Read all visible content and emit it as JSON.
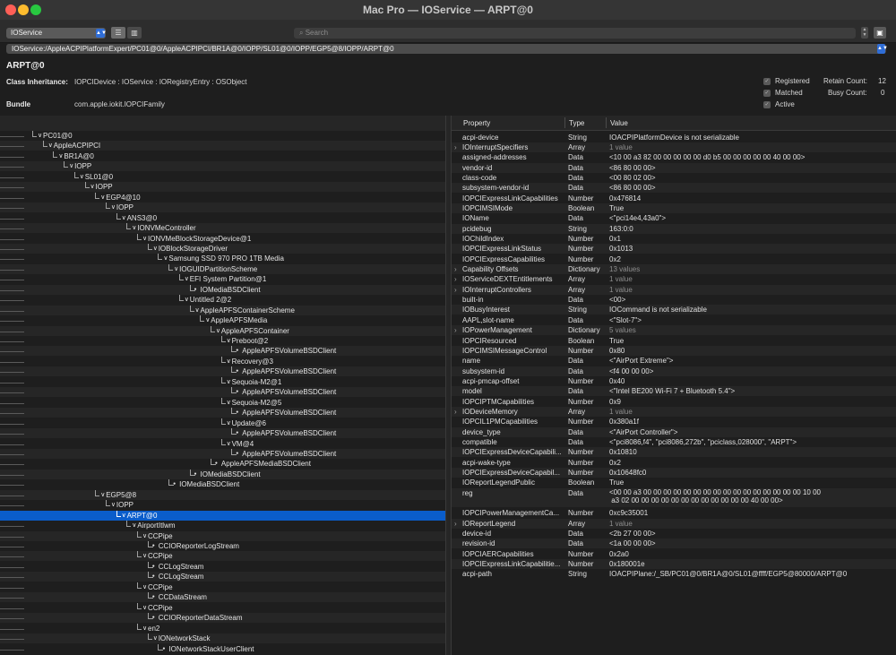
{
  "window": {
    "title": "Mac Pro — IOService — ARPT@0"
  },
  "toolbar": {
    "plane": "IOService",
    "search_placeholder": "Search",
    "view_list_icon": "list-icon",
    "view_browser_icon": "columns-icon"
  },
  "path": "IOService:/AppleACPIPlatformExpert/PC01@0/AppleACPIPCI/BR1A@0/IOPP/SL01@0/IOPP/EGP5@8/IOPP/ARPT@0",
  "entry": {
    "name": "ARPT@0",
    "class_label": "Class Inheritance:",
    "class_value": "IOPCIDevice : IOService : IORegistryEntry : OSObject",
    "bundle_label": "Bundle",
    "bundle_value": "com.apple.iokit.IOPCIFamily",
    "registered": "Registered",
    "matched": "Matched",
    "active": "Active",
    "retain_label": "Retain Count:",
    "retain_value": "12",
    "busy_label": "Busy Count:",
    "busy_value": "0"
  },
  "tree": [
    {
      "label": "PC01@0",
      "level": 0
    },
    {
      "label": "AppleACPIPCI",
      "level": 1
    },
    {
      "label": "BR1A@0",
      "level": 2
    },
    {
      "label": "IOPP",
      "level": 3
    },
    {
      "label": "SL01@0",
      "level": 4
    },
    {
      "label": "IOPP",
      "level": 5
    },
    {
      "label": "EGP4@10",
      "level": 6
    },
    {
      "label": "IOPP",
      "level": 7
    },
    {
      "label": "ANS3@0",
      "level": 8
    },
    {
      "label": "IONVMeController",
      "level": 9
    },
    {
      "label": "IONVMeBlockStorageDevice@1",
      "level": 10
    },
    {
      "label": "IOBlockStorageDriver",
      "level": 11
    },
    {
      "label": "Samsung SSD 970 PRO 1TB Media",
      "level": 12
    },
    {
      "label": "IOGUIDPartitionScheme",
      "level": 13
    },
    {
      "label": "EFI System Partition@1",
      "level": 14
    },
    {
      "label": "IOMediaBSDClient",
      "level": 15,
      "leaf": true
    },
    {
      "label": "Untitled 2@2",
      "level": 14
    },
    {
      "label": "AppleAPFSContainerScheme",
      "level": 15
    },
    {
      "label": "AppleAPFSMedia",
      "level": 16
    },
    {
      "label": "AppleAPFSContainer",
      "level": 17
    },
    {
      "label": "Preboot@2",
      "level": 18
    },
    {
      "label": "AppleAPFSVolumeBSDClient",
      "level": 19,
      "leaf": true
    },
    {
      "label": "Recovery@3",
      "level": 18
    },
    {
      "label": "AppleAPFSVolumeBSDClient",
      "level": 19,
      "leaf": true
    },
    {
      "label": "Sequoia-M2@1",
      "level": 18
    },
    {
      "label": "AppleAPFSVolumeBSDClient",
      "level": 19,
      "leaf": true
    },
    {
      "label": "Sequoia-M2@5",
      "level": 18
    },
    {
      "label": "AppleAPFSVolumeBSDClient",
      "level": 19,
      "leaf": true
    },
    {
      "label": "Update@6",
      "level": 18
    },
    {
      "label": "AppleAPFSVolumeBSDClient",
      "level": 19,
      "leaf": true
    },
    {
      "label": "VM@4",
      "level": 18
    },
    {
      "label": "AppleAPFSVolumeBSDClient",
      "level": 19,
      "leaf": true
    },
    {
      "label": "AppleAPFSMediaBSDClient",
      "level": 17,
      "leaf": true
    },
    {
      "label": "IOMediaBSDClient",
      "level": 15,
      "leaf": true
    },
    {
      "label": "IOMediaBSDClient",
      "level": 13,
      "leaf": true
    },
    {
      "label": "EGP5@8",
      "level": 6
    },
    {
      "label": "IOPP",
      "level": 7
    },
    {
      "label": "ARPT@0",
      "level": 8,
      "selected": true
    },
    {
      "label": "AirportItlwm",
      "level": 9
    },
    {
      "label": "CCPipe",
      "level": 10
    },
    {
      "label": "CCIOReporterLogStream",
      "level": 11,
      "leaf": true
    },
    {
      "label": "CCPipe",
      "level": 10
    },
    {
      "label": "CCLogStream",
      "level": 11,
      "leaf": true
    },
    {
      "label": "CCLogStream",
      "level": 11,
      "leaf": true
    },
    {
      "label": "CCPipe",
      "level": 10
    },
    {
      "label": "CCDataStream",
      "level": 11,
      "leaf": true
    },
    {
      "label": "CCPipe",
      "level": 10
    },
    {
      "label": "CCIOReporterDataStream",
      "level": 11,
      "leaf": true
    },
    {
      "label": "en2",
      "level": 10
    },
    {
      "label": "IONetworkStack",
      "level": 11
    },
    {
      "label": "IONetworkStackUserClient",
      "level": 12,
      "leaf": true
    }
  ],
  "props_header": {
    "property": "Property",
    "type": "Type",
    "value": "Value"
  },
  "props": [
    {
      "p": "acpi-device",
      "t": "String",
      "v": "IOACPIPlatformDevice is not serializable"
    },
    {
      "p": "IOInterruptSpecifiers",
      "t": "Array",
      "v": "1 value",
      "disc": true,
      "muted": true
    },
    {
      "p": "assigned-addresses",
      "t": "Data",
      "v": "<10 00 a3 82 00 00 00 00 00 d0 b5 00 00 00 00 00 40 00 00>"
    },
    {
      "p": "vendor-id",
      "t": "Data",
      "v": "<86 80 00 00>"
    },
    {
      "p": "class-code",
      "t": "Data",
      "v": "<00 80 02 00>"
    },
    {
      "p": "subsystem-vendor-id",
      "t": "Data",
      "v": "<86 80 00 00>"
    },
    {
      "p": "IOPCIExpressLinkCapabilities",
      "t": "Number",
      "v": "0x476814"
    },
    {
      "p": "IOPCIMSIMode",
      "t": "Boolean",
      "v": "True"
    },
    {
      "p": "IOName",
      "t": "Data",
      "v": "<\"pci14e4,43a0\">"
    },
    {
      "p": "pcidebug",
      "t": "String",
      "v": "163:0:0"
    },
    {
      "p": "IOChildIndex",
      "t": "Number",
      "v": "0x1"
    },
    {
      "p": "IOPCIExpressLinkStatus",
      "t": "Number",
      "v": "0x1013"
    },
    {
      "p": "IOPCIExpressCapabilities",
      "t": "Number",
      "v": "0x2"
    },
    {
      "p": "Capability Offsets",
      "t": "Dictionary",
      "v": "13 values",
      "disc": true,
      "muted": true
    },
    {
      "p": "IOServiceDEXTEntitlements",
      "t": "Array",
      "v": "1 value",
      "disc": true,
      "muted": true
    },
    {
      "p": "IOInterruptControllers",
      "t": "Array",
      "v": "1 value",
      "disc": true,
      "muted": true
    },
    {
      "p": "built-in",
      "t": "Data",
      "v": "<00>"
    },
    {
      "p": "IOBusyInterest",
      "t": "String",
      "v": "IOCommand is not serializable"
    },
    {
      "p": "AAPL,slot-name",
      "t": "Data",
      "v": "<\"Slot-7\">"
    },
    {
      "p": "IOPowerManagement",
      "t": "Dictionary",
      "v": "5 values",
      "disc": true,
      "muted": true
    },
    {
      "p": "IOPCIResourced",
      "t": "Boolean",
      "v": "True"
    },
    {
      "p": "IOPCIMSIMessageControl",
      "t": "Number",
      "v": "0x80"
    },
    {
      "p": "name",
      "t": "Data",
      "v": "<\"AirPort Extreme\">"
    },
    {
      "p": "subsystem-id",
      "t": "Data",
      "v": "<f4 00 00 00>"
    },
    {
      "p": "acpi-pmcap-offset",
      "t": "Number",
      "v": "0x40"
    },
    {
      "p": "model",
      "t": "Data",
      "v": "<\"Intel BE200 Wi-Fi 7 + Bluetooth 5.4\">"
    },
    {
      "p": "IOPCIPTMCapabilities",
      "t": "Number",
      "v": "0x9"
    },
    {
      "p": "IODeviceMemory",
      "t": "Array",
      "v": "1 value",
      "disc": true,
      "muted": true
    },
    {
      "p": "IOPCIL1PMCapabilities",
      "t": "Number",
      "v": "0x380a1f"
    },
    {
      "p": "device_type",
      "t": "Data",
      "v": "<\"AirPort Controller\">"
    },
    {
      "p": "compatible",
      "t": "Data",
      "v": "<\"pci8086,f4\", \"pci8086,272b\", \"pciclass,028000\", \"ARPT\">"
    },
    {
      "p": "IOPCIExpressDeviceCapabili...",
      "t": "Number",
      "v": "0x10810"
    },
    {
      "p": "acpi-wake-type",
      "t": "Number",
      "v": "0x2"
    },
    {
      "p": "IOPCIExpressDeviceCapabil...",
      "t": "Number",
      "v": "0x10648fc0"
    },
    {
      "p": "IOReportLegendPublic",
      "t": "Boolean",
      "v": "True"
    },
    {
      "p": "reg",
      "t": "Data",
      "v": "<00 00 a3 00 00 00 00 00 00 00 00 00 00 00 00 00 00 00 00 10 00\n a3 02 00 00 00 00 00 00 00 00 00 00 00 00 40 00 00>",
      "tall": true
    },
    {
      "p": "IOPCIPowerManagementCa...",
      "t": "Number",
      "v": "0xc9c35001"
    },
    {
      "p": "IOReportLegend",
      "t": "Array",
      "v": "1 value",
      "disc": true,
      "muted": true
    },
    {
      "p": "device-id",
      "t": "Data",
      "v": "<2b 27 00 00>"
    },
    {
      "p": "revision-id",
      "t": "Data",
      "v": "<1a 00 00 00>"
    },
    {
      "p": "IOPCIAERCapabilities",
      "t": "Number",
      "v": "0x2a0"
    },
    {
      "p": "IOPCIExpressLinkCapabilitie...",
      "t": "Number",
      "v": "0x180001e"
    },
    {
      "p": "acpi-path",
      "t": "String",
      "v": "IOACPIPlane:/_SB/PC01@0/BR1A@0/SL01@ffff/EGP5@80000/ARPT@0"
    }
  ],
  "colors": {
    "accent": "#0a5dcb",
    "popup_arrow": "#2f6dd6"
  }
}
